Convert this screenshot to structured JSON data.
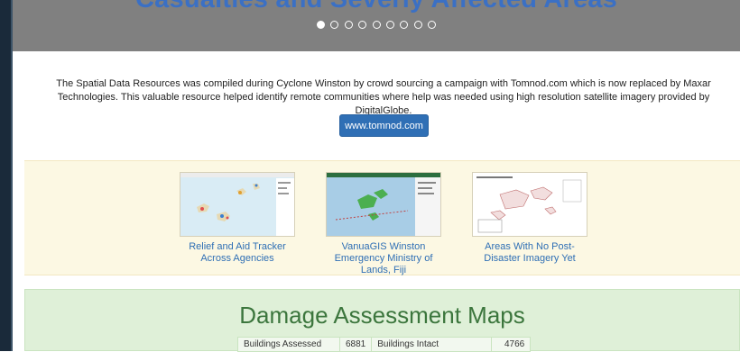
{
  "hero": {
    "title": "Casualties and Severly Affected Areas",
    "slide_count": 9,
    "active_slide": 1
  },
  "intro": {
    "text": "The Spatial Data Resources was compiled during Cyclone Winston by crowd sourcing a campaign with Tomnod.com which is now replaced by Maxar Technologies. This valuable resource helped identify remote communities where help was needed using high resolution satellite imagery provided by DigitalGlobe.",
    "button_label": "www.tomnod.com"
  },
  "resources": {
    "cards": [
      {
        "label": "Relief and Aid Tracker Across Agencies",
        "icon": "map-thumbnail"
      },
      {
        "label": "VanuaGIS Winston Emergency Ministry of Lands, Fiji",
        "icon": "map-thumbnail"
      },
      {
        "label": "Areas With No Post-Disaster Imagery Yet",
        "icon": "map-thumbnail"
      }
    ]
  },
  "damage": {
    "title": "Damage Assessment Maps",
    "stats": [
      {
        "label": "Buildings Assessed",
        "value": "6881"
      },
      {
        "label": "Buildings Intact",
        "value": "4766"
      }
    ]
  },
  "colors": {
    "hero_bg": "#808080",
    "hero_title": "#3b70c4",
    "button": "#2f6fb5",
    "resources_bg": "#fcf8e3",
    "damage_bg": "#dff0d8",
    "damage_title": "#3c763d"
  }
}
